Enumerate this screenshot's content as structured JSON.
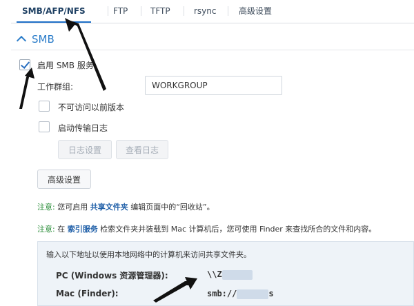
{
  "tabs": [
    {
      "label": "SMB/AFP/NFS",
      "active": true
    },
    {
      "label": "FTP"
    },
    {
      "label": "TFTP"
    },
    {
      "label": "rsync"
    },
    {
      "label": "高级设置"
    }
  ],
  "smb": {
    "section_title": "SMB",
    "enable_label": "启用 SMB 服务",
    "enable_checked": true,
    "workgroup_label": "工作群组:",
    "workgroup_value": "WORKGROUP",
    "prev_versions_label": "不可访问以前版本",
    "prev_versions_checked": false,
    "transfer_log_label": "启动传输日志",
    "transfer_log_checked": false,
    "log_settings_button": "日志设置",
    "view_log_button": "查看日志",
    "advanced_button": "高级设置"
  },
  "notes": [
    {
      "tag": "注意:",
      "pre": "您可启用",
      "link": "共享文件夹",
      "post": "编辑页面中的“回收站”。"
    },
    {
      "tag": "注意:",
      "pre": "在",
      "link": "索引服务",
      "post": "检索文件夹并装载到 Mac 计算机后，您可使用 Finder 来查找所合的文件和内容。"
    }
  ],
  "access": {
    "intro": "输入以下地址以使用本地网络中的计算机来访问共享文件夹。",
    "pc_label": "PC (Windows 资源管理器):",
    "pc_value_prefix": "\\\\Z",
    "mac_label": "Mac (Finder):",
    "mac_value_prefix": "smb://",
    "mac_value_suffix": "s"
  },
  "colors": {
    "accent": "#1e6fc7",
    "note_tag": "#2d8f3c",
    "link": "#1f5fa8",
    "arrow": "#111111"
  }
}
